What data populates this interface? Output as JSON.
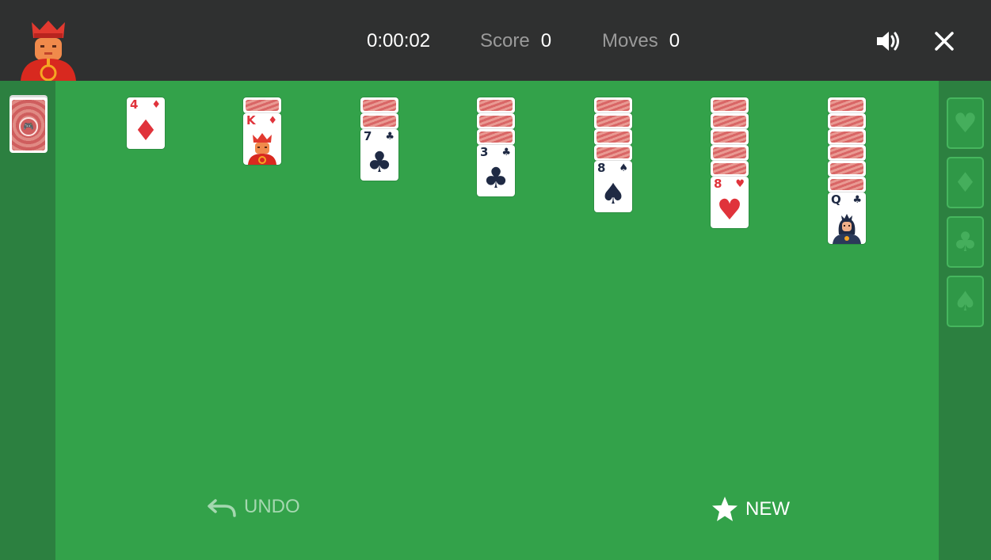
{
  "header": {
    "timer": "0:00:02",
    "score_label": "Score",
    "score_value": "0",
    "moves_label": "Moves",
    "moves_value": "0",
    "sound_icon": "speaker-icon",
    "close_icon": "close-icon"
  },
  "stock": {
    "icon": "gamepad-icon"
  },
  "tableau": [
    {
      "face_down": 0,
      "rank": "4",
      "suit": "♦",
      "color": "#e0333b"
    },
    {
      "face_down": 1,
      "rank": "K",
      "suit": "♦",
      "color": "#e0333b",
      "face": "king"
    },
    {
      "face_down": 2,
      "rank": "7",
      "suit": "♣",
      "color": "#1f2a44"
    },
    {
      "face_down": 3,
      "rank": "3",
      "suit": "♣",
      "color": "#1f2a44"
    },
    {
      "face_down": 4,
      "rank": "8",
      "suit": "♠",
      "color": "#1f2a44"
    },
    {
      "face_down": 5,
      "rank": "8",
      "suit": "♥",
      "color": "#e0333b"
    },
    {
      "face_down": 6,
      "rank": "Q",
      "suit": "♣",
      "color": "#1f2a44",
      "face": "queen"
    }
  ],
  "foundations": [
    {
      "suit": "♥"
    },
    {
      "suit": "♦"
    },
    {
      "suit": "♣"
    },
    {
      "suit": "♠"
    }
  ],
  "actions": {
    "undo_label": "UNDO",
    "new_label": "NEW"
  },
  "colors": {
    "felt": "#33a24a",
    "side": "#2c8040",
    "topbar": "#2f3030",
    "red_suit": "#e0333b",
    "black_suit": "#1f2a44"
  }
}
